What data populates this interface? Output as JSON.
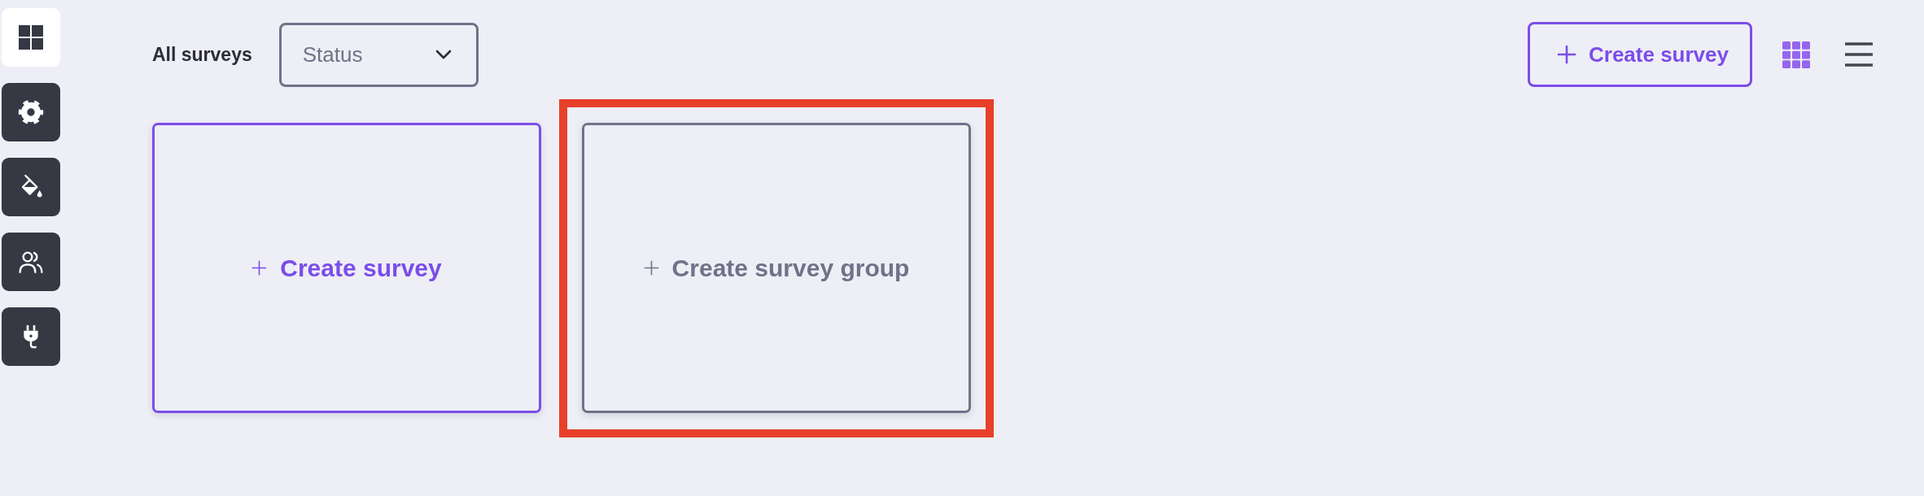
{
  "sidebar": {
    "items": [
      {
        "selected": true
      },
      {
        "selected": false
      },
      {
        "selected": false
      },
      {
        "selected": false
      },
      {
        "selected": false
      }
    ]
  },
  "header": {
    "title": "All surveys",
    "status_filter": {
      "placeholder": "Status"
    },
    "create_button": {
      "label": "Create survey"
    },
    "view_toggles": [
      {
        "selected": true
      },
      {
        "selected": false
      }
    ]
  },
  "cards": [
    {
      "kind": "primary",
      "label": "Create survey",
      "highlighted": false
    },
    {
      "kind": "secondary",
      "label": "Create survey group",
      "highlighted": true
    }
  ]
}
